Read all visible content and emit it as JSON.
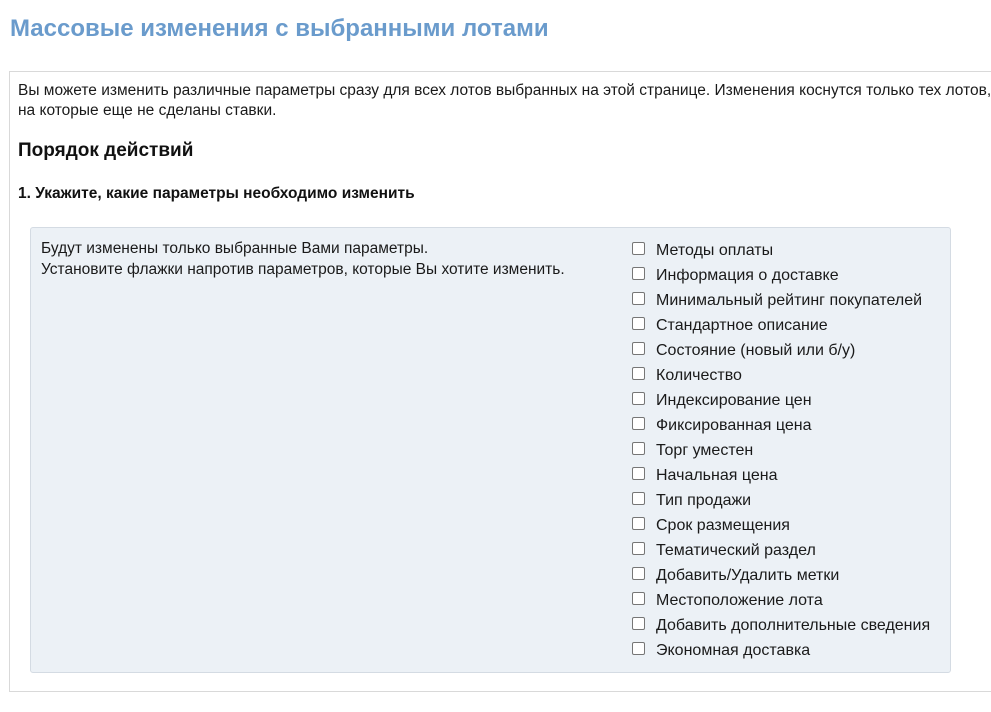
{
  "page": {
    "title": "Массовые изменения с выбранными лотами"
  },
  "intro": {
    "text": "Вы можете изменить различные параметры сразу для всех лотов выбранных на этой странице. Изменения коснутся только тех лотов, на которые еще не сделаны ставки."
  },
  "procedure": {
    "title": "Порядок действий",
    "step1_title": "1. Укажите, какие параметры необходимо изменить"
  },
  "params": {
    "hint_line1": "Будут изменены только выбранные Вами параметры.",
    "hint_line2": "Установите флажки напротив параметров, которые Вы хотите изменить.",
    "options": [
      {
        "label": "Методы оплаты",
        "checked": false
      },
      {
        "label": "Информация о доставке",
        "checked": false
      },
      {
        "label": "Минимальный рейтинг покупателей",
        "checked": false
      },
      {
        "label": "Стандартное описание",
        "checked": false
      },
      {
        "label": "Состояние (новый или б/у)",
        "checked": false
      },
      {
        "label": "Количество",
        "checked": false
      },
      {
        "label": "Индексирование цен",
        "checked": false
      },
      {
        "label": "Фиксированная цена",
        "checked": false
      },
      {
        "label": "Торг уместен",
        "checked": false
      },
      {
        "label": "Начальная цена",
        "checked": false
      },
      {
        "label": "Тип продажи",
        "checked": false
      },
      {
        "label": "Срок размещения",
        "checked": false
      },
      {
        "label": "Тематический раздел",
        "checked": false
      },
      {
        "label": "Добавить/Удалить метки",
        "checked": false
      },
      {
        "label": "Местоположение лота",
        "checked": false
      },
      {
        "label": "Добавить дополнительные сведения",
        "checked": false
      },
      {
        "label": "Экономная доставка",
        "checked": false
      }
    ]
  },
  "colors": {
    "title": "#6a9bcc",
    "params_background": "#ecf1f6"
  }
}
